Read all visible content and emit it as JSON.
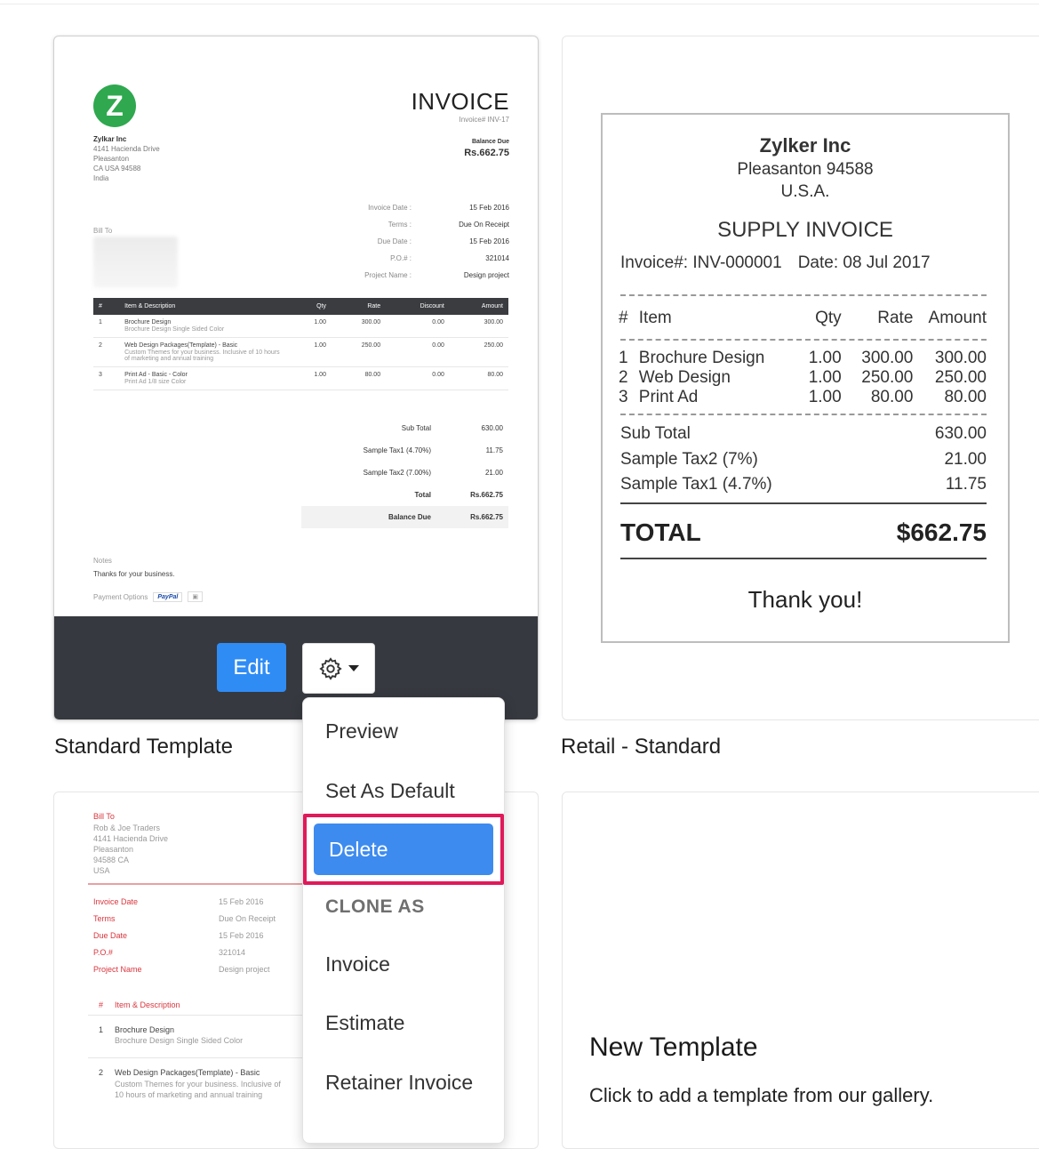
{
  "standard_invoice": {
    "logo_letter": "Z",
    "title": "INVOICE",
    "invoice_no": "Invoice# INV-17",
    "company": [
      "Zylkar Inc",
      "4141 Hacienda Drive",
      "Pleasanton",
      "CA USA 94588",
      "India"
    ],
    "balance_label": "Balance Due",
    "balance_amount": "Rs.662.75",
    "meta": [
      {
        "k": "Invoice Date :",
        "v": "15 Feb 2016"
      },
      {
        "k": "Terms :",
        "v": "Due On Receipt"
      },
      {
        "k": "Due Date :",
        "v": "15 Feb 2016"
      },
      {
        "k": "P.O.# :",
        "v": "321014"
      },
      {
        "k": "Project Name :",
        "v": "Design project"
      }
    ],
    "bill_to": "Bill To",
    "headers": [
      "#",
      "Item & Description",
      "Qty",
      "Rate",
      "Discount",
      "Amount"
    ],
    "items": [
      {
        "n": "1",
        "name": "Brochure Design",
        "desc": "Brochure Design Single Sided Color",
        "qty": "1.00",
        "rate": "300.00",
        "disc": "0.00",
        "amt": "300.00"
      },
      {
        "n": "2",
        "name": "Web Design Packages(Template) - Basic",
        "desc": "Custom Themes for your business. Inclusive of 10 hours of marketing and annual training",
        "qty": "1.00",
        "rate": "250.00",
        "disc": "0.00",
        "amt": "250.00"
      },
      {
        "n": "3",
        "name": "Print Ad - Basic - Color",
        "desc": "Print Ad 1/8 size Color",
        "qty": "1.00",
        "rate": "80.00",
        "disc": "0.00",
        "amt": "80.00"
      }
    ],
    "totals": [
      {
        "k": "Sub Total",
        "v": "630.00"
      },
      {
        "k": "Sample Tax1 (4.70%)",
        "v": "11.75"
      },
      {
        "k": "Sample Tax2 (7.00%)",
        "v": "21.00"
      },
      {
        "k": "Total",
        "v": "Rs.662.75"
      },
      {
        "k": "Balance Due",
        "v": "Rs.662.75"
      }
    ],
    "notes_label": "Notes",
    "notes_text": "Thanks for your business.",
    "payment_label": "Payment Options",
    "paypal": "PayPal"
  },
  "actions": {
    "edit": "Edit"
  },
  "captions": {
    "standard": "Standard Template",
    "retail": "Retail - Standard"
  },
  "retail": {
    "company": "Zylker Inc",
    "city": "Pleasanton  94588",
    "country": "U.S.A.",
    "title": "SUPPLY INVOICE",
    "invoice_no": "Invoice#: INV-000001",
    "date": "Date: 08 Jul 2017",
    "headers": [
      "#",
      "Item",
      "Qty",
      "Rate",
      "Amount"
    ],
    "items": [
      {
        "n": "1",
        "name": "Brochure Design",
        "qty": "1.00",
        "rate": "300.00",
        "amt": "300.00"
      },
      {
        "n": "2",
        "name": "Web Design",
        "qty": "1.00",
        "rate": "250.00",
        "amt": "250.00"
      },
      {
        "n": "3",
        "name": "Print Ad",
        "qty": "1.00",
        "rate": "80.00",
        "amt": "80.00"
      }
    ],
    "sums": [
      {
        "k": "Sub Total",
        "v": "630.00"
      },
      {
        "k": "Sample Tax2 (7%)",
        "v": "21.00"
      },
      {
        "k": "Sample Tax1 (4.7%)",
        "v": "11.75"
      }
    ],
    "total_label": "TOTAL",
    "total_value": "$662.75",
    "thanks": "Thank you!"
  },
  "third_template": {
    "bill_to": "Bill To",
    "address": [
      "Rob & Joe Traders",
      "4141 Hacienda Drive",
      "Pleasanton",
      "94588 CA",
      "USA"
    ],
    "meta": [
      {
        "k": "Invoice Date",
        "v": "15 Feb 2016"
      },
      {
        "k": "Terms",
        "v": "Due On Receipt"
      },
      {
        "k": "Due Date",
        "v": "15 Feb 2016"
      },
      {
        "k": "P.O.#",
        "v": "321014"
      },
      {
        "k": "Project Name",
        "v": "Design project"
      }
    ],
    "header_n": "#",
    "header_item": "Item & Description",
    "items": [
      {
        "n": "1",
        "name": "Brochure Design",
        "desc": "Brochure Design Single Sided Color"
      },
      {
        "n": "2",
        "name": "Web Design Packages(Template) - Basic",
        "desc": "Custom Themes for your business. Inclusive of 10 hours of marketing and annual training"
      }
    ]
  },
  "new_template": {
    "title": "New Template",
    "description": "Click to add a template from our gallery."
  },
  "menu": {
    "preview": "Preview",
    "set_default": "Set As Default",
    "delete": "Delete",
    "clone_as": "CLONE AS",
    "invoice": "Invoice",
    "estimate": "Estimate",
    "retainer_invoice": "Retainer Invoice"
  },
  "colors": {
    "edit_button": "#2f8cf5",
    "delete_highlight": "#3d8bef",
    "delete_outline": "#e0195a",
    "logo_green": "#2fa84f",
    "template_red": "#d9363e"
  }
}
